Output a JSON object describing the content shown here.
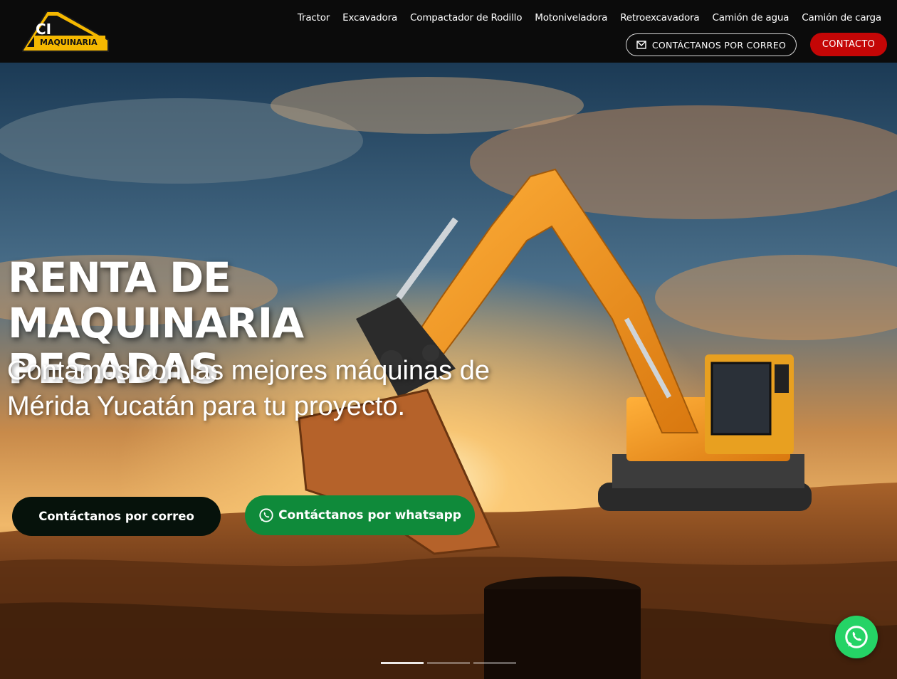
{
  "brand": {
    "logo_initials": "CI",
    "logo_word": "MAQUINARIA",
    "logo_color": "#f5b800"
  },
  "nav": {
    "items": [
      {
        "label": "Tractor"
      },
      {
        "label": "Excavadora"
      },
      {
        "label": "Compactador de Rodillo"
      },
      {
        "label": "Motoniveladora"
      },
      {
        "label": "Retroexcavadora"
      },
      {
        "label": "Camión de agua"
      },
      {
        "label": "Camión de carga"
      }
    ],
    "mail_button": "CONTÁCTANOS POR CORREO",
    "contact_button": "CONTACTO",
    "contact_color": "#c40606"
  },
  "hero": {
    "title_line1": "RENTA DE MAQUINARIA",
    "title_line2": "PESADAS",
    "subtitle": "Contamos con las mejores máquinas de Mérida Yucatán para tu proyecto.",
    "btn_mail": "Contáctanos por correo",
    "btn_whatsapp": "Contáctanos por whatsapp",
    "whatsapp_color": "#0f8a3a",
    "slides": [
      {
        "active": true
      },
      {
        "active": false
      },
      {
        "active": false
      }
    ]
  },
  "icons": {
    "mail": "envelope-icon",
    "whatsapp": "whatsapp-icon"
  }
}
